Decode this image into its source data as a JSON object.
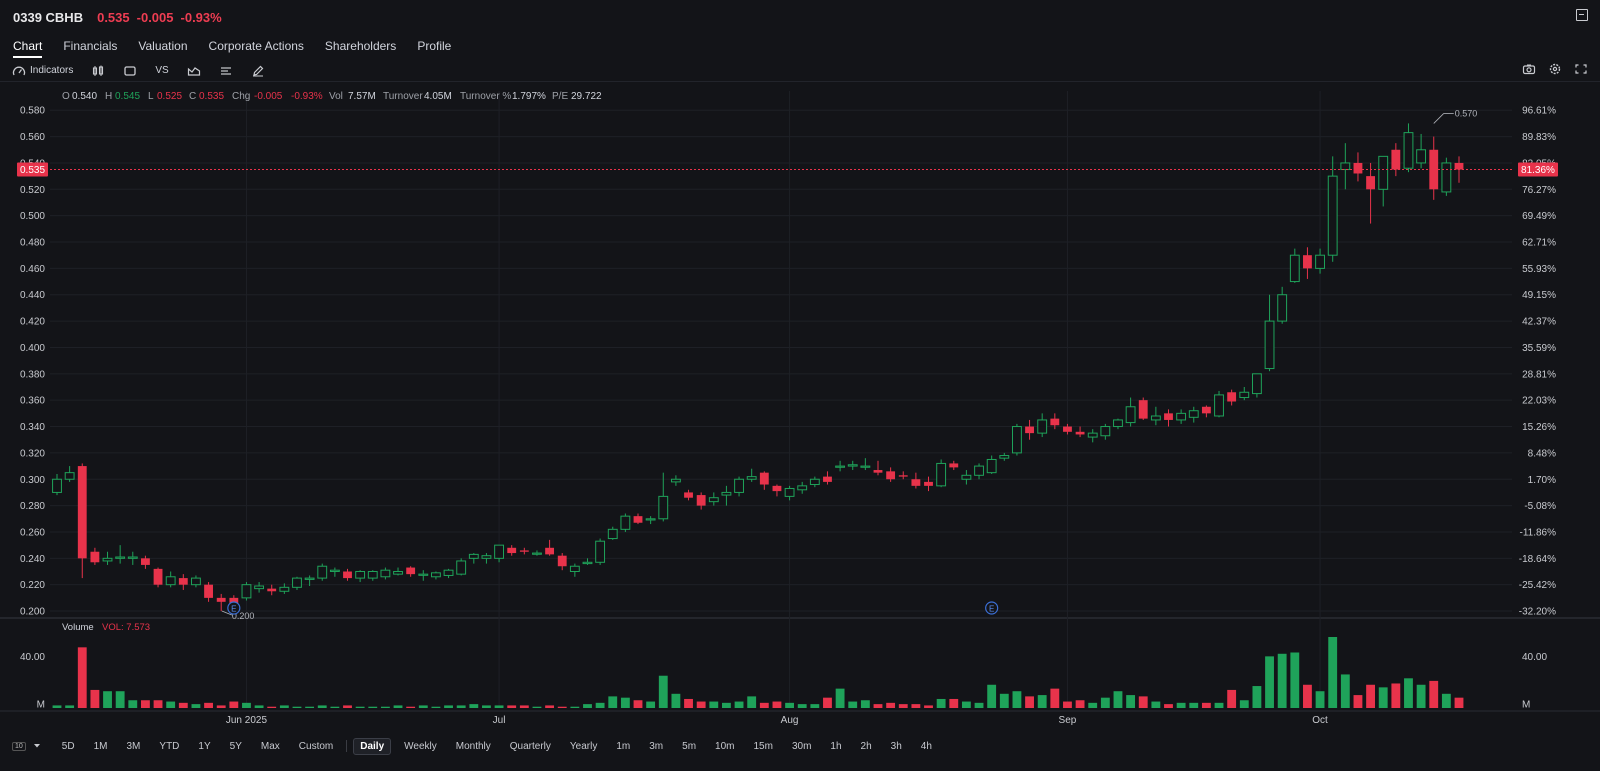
{
  "header": {
    "symbol": "0339 CBHB",
    "price": "0.535",
    "change": "-0.005",
    "change_pct": "-0.93%"
  },
  "tabs": [
    "Chart",
    "Financials",
    "Valuation",
    "Corporate Actions",
    "Shareholders",
    "Profile"
  ],
  "toolbar": {
    "indicators_label": "Indicators",
    "vs_label": "VS"
  },
  "ohlc_bar": {
    "o_label": "O",
    "o_value": "0.540",
    "h_label": "H",
    "h_value": "0.545",
    "l_label": "L",
    "l_value": "0.525",
    "c_label": "C",
    "c_value": "0.535",
    "chg_label": "Chg",
    "chg_value": "-0.005",
    "chg_pct": "-0.93%",
    "vol_label": "Vol",
    "vol_value": "7.57M",
    "turnover_label": "Turnover",
    "turnover_value": "4.05M",
    "turnover_pct_label": "Turnover %",
    "turnover_pct_value": "1.797%",
    "pe_label": "P/E",
    "pe_value": "29.722"
  },
  "volume_legend": {
    "label": "Volume",
    "value_text": "VOL: 7.573"
  },
  "footer": {
    "interval_box": "10",
    "ranges": [
      "5D",
      "1M",
      "3M",
      "YTD",
      "1Y",
      "5Y",
      "Max",
      "Custom"
    ],
    "periods": [
      "Daily",
      "Weekly",
      "Monthly",
      "Quarterly",
      "Yearly",
      "1m",
      "3m",
      "5m",
      "10m",
      "15m",
      "30m",
      "1h",
      "2h",
      "3h",
      "4h"
    ],
    "selected_period": "Daily"
  },
  "colors": {
    "up": "#1fa35a",
    "down": "#e8334b",
    "background": "#131418",
    "grid": "#1e2026",
    "text": "#d1d4dc"
  },
  "chart_data": {
    "type": "candlestick",
    "y_ticks": [
      "0.580",
      "0.560",
      "0.540",
      "0.520",
      "0.500",
      "0.480",
      "0.460",
      "0.440",
      "0.420",
      "0.400",
      "0.380",
      "0.360",
      "0.340",
      "0.320",
      "0.300",
      "0.280",
      "0.260",
      "0.240",
      "0.220",
      "0.200"
    ],
    "y_right_ticks": [
      "96.61%",
      "89.83%",
      "83.05%",
      "76.27%",
      "69.49%",
      "62.71%",
      "55.93%",
      "49.15%",
      "42.37%",
      "35.59%",
      "28.81%",
      "22.03%",
      "15.26%",
      "8.48%",
      "1.70%",
      "-5.08%",
      "-11.86%",
      "-18.64%",
      "-25.42%",
      "-32.20%"
    ],
    "ylim": [
      0.197,
      0.587
    ],
    "last_price": 0.535,
    "last_price_label": "0.535",
    "last_pct_label": "81.36%",
    "x_labels": [
      {
        "label": "Jun 2025",
        "index": 15
      },
      {
        "label": "Jul",
        "index": 35
      },
      {
        "label": "Aug",
        "index": 58
      },
      {
        "label": "Sep",
        "index": 80
      },
      {
        "label": "Oct",
        "index": 100
      }
    ],
    "high_annotation": {
      "label": "0.570",
      "index": 109,
      "value": 0.57
    },
    "low_annotation": {
      "label": "0.200",
      "index": 14,
      "value": 0.2
    },
    "events": [
      {
        "label": "E",
        "index": 14
      },
      {
        "label": "E",
        "index": 74
      }
    ],
    "volume_ticks": [
      {
        "label": "40.00",
        "value": 40
      },
      {
        "label": "M",
        "value": 0
      }
    ],
    "volume_max": 55,
    "volume_right_ticks": [
      {
        "label": "40.00",
        "value": 40
      },
      {
        "label": "M",
        "value": 0
      }
    ],
    "candles": [
      {
        "o": 0.29,
        "h": 0.304,
        "l": 0.288,
        "c": 0.3,
        "v": 2
      },
      {
        "o": 0.3,
        "h": 0.31,
        "l": 0.298,
        "c": 0.305,
        "v": 2
      },
      {
        "o": 0.31,
        "h": 0.312,
        "l": 0.225,
        "c": 0.24,
        "v": 47
      },
      {
        "o": 0.245,
        "h": 0.248,
        "l": 0.235,
        "c": 0.237,
        "v": 14
      },
      {
        "o": 0.238,
        "h": 0.245,
        "l": 0.235,
        "c": 0.24,
        "v": 13
      },
      {
        "o": 0.24,
        "h": 0.25,
        "l": 0.236,
        "c": 0.241,
        "v": 13
      },
      {
        "o": 0.24,
        "h": 0.245,
        "l": 0.235,
        "c": 0.241,
        "v": 6
      },
      {
        "o": 0.24,
        "h": 0.242,
        "l": 0.232,
        "c": 0.235,
        "v": 6
      },
      {
        "o": 0.232,
        "h": 0.233,
        "l": 0.218,
        "c": 0.22,
        "v": 6
      },
      {
        "o": 0.22,
        "h": 0.23,
        "l": 0.218,
        "c": 0.226,
        "v": 5
      },
      {
        "o": 0.225,
        "h": 0.228,
        "l": 0.216,
        "c": 0.22,
        "v": 4
      },
      {
        "o": 0.22,
        "h": 0.227,
        "l": 0.218,
        "c": 0.225,
        "v": 3
      },
      {
        "o": 0.22,
        "h": 0.222,
        "l": 0.207,
        "c": 0.21,
        "v": 4
      },
      {
        "o": 0.21,
        "h": 0.213,
        "l": 0.2,
        "c": 0.207,
        "v": 2
      },
      {
        "o": 0.21,
        "h": 0.212,
        "l": 0.202,
        "c": 0.205,
        "v": 5
      },
      {
        "o": 0.21,
        "h": 0.222,
        "l": 0.208,
        "c": 0.22,
        "v": 4
      },
      {
        "o": 0.217,
        "h": 0.222,
        "l": 0.214,
        "c": 0.219,
        "v": 2
      },
      {
        "o": 0.217,
        "h": 0.22,
        "l": 0.212,
        "c": 0.215,
        "v": 1
      },
      {
        "o": 0.215,
        "h": 0.221,
        "l": 0.213,
        "c": 0.218,
        "v": 2
      },
      {
        "o": 0.218,
        "h": 0.226,
        "l": 0.216,
        "c": 0.225,
        "v": 1
      },
      {
        "o": 0.224,
        "h": 0.227,
        "l": 0.219,
        "c": 0.225,
        "v": 1
      },
      {
        "o": 0.225,
        "h": 0.236,
        "l": 0.223,
        "c": 0.234,
        "v": 2
      },
      {
        "o": 0.23,
        "h": 0.233,
        "l": 0.226,
        "c": 0.231,
        "v": 1
      },
      {
        "o": 0.23,
        "h": 0.232,
        "l": 0.223,
        "c": 0.225,
        "v": 2
      },
      {
        "o": 0.225,
        "h": 0.231,
        "l": 0.222,
        "c": 0.23,
        "v": 1
      },
      {
        "o": 0.225,
        "h": 0.231,
        "l": 0.223,
        "c": 0.23,
        "v": 1
      },
      {
        "o": 0.226,
        "h": 0.233,
        "l": 0.224,
        "c": 0.231,
        "v": 1
      },
      {
        "o": 0.228,
        "h": 0.233,
        "l": 0.227,
        "c": 0.23,
        "v": 2
      },
      {
        "o": 0.233,
        "h": 0.234,
        "l": 0.226,
        "c": 0.228,
        "v": 1
      },
      {
        "o": 0.228,
        "h": 0.231,
        "l": 0.223,
        "c": 0.228,
        "v": 2
      },
      {
        "o": 0.226,
        "h": 0.23,
        "l": 0.224,
        "c": 0.229,
        "v": 1
      },
      {
        "o": 0.227,
        "h": 0.232,
        "l": 0.225,
        "c": 0.231,
        "v": 2
      },
      {
        "o": 0.228,
        "h": 0.24,
        "l": 0.227,
        "c": 0.238,
        "v": 2
      },
      {
        "o": 0.24,
        "h": 0.244,
        "l": 0.236,
        "c": 0.243,
        "v": 3
      },
      {
        "o": 0.24,
        "h": 0.244,
        "l": 0.236,
        "c": 0.242,
        "v": 2
      },
      {
        "o": 0.24,
        "h": 0.248,
        "l": 0.237,
        "c": 0.25,
        "v": 2
      },
      {
        "o": 0.248,
        "h": 0.25,
        "l": 0.242,
        "c": 0.244,
        "v": 2
      },
      {
        "o": 0.246,
        "h": 0.248,
        "l": 0.243,
        "c": 0.245,
        "v": 2
      },
      {
        "o": 0.244,
        "h": 0.246,
        "l": 0.242,
        "c": 0.244,
        "v": 1
      },
      {
        "o": 0.248,
        "h": 0.254,
        "l": 0.242,
        "c": 0.243,
        "v": 2
      },
      {
        "o": 0.242,
        "h": 0.244,
        "l": 0.231,
        "c": 0.234,
        "v": 1
      },
      {
        "o": 0.23,
        "h": 0.236,
        "l": 0.226,
        "c": 0.234,
        "v": 1
      },
      {
        "o": 0.236,
        "h": 0.24,
        "l": 0.235,
        "c": 0.237,
        "v": 3
      },
      {
        "o": 0.237,
        "h": 0.255,
        "l": 0.235,
        "c": 0.253,
        "v": 4
      },
      {
        "o": 0.255,
        "h": 0.264,
        "l": 0.254,
        "c": 0.262,
        "v": 9
      },
      {
        "o": 0.262,
        "h": 0.274,
        "l": 0.26,
        "c": 0.272,
        "v": 8
      },
      {
        "o": 0.272,
        "h": 0.274,
        "l": 0.266,
        "c": 0.267,
        "v": 6
      },
      {
        "o": 0.27,
        "h": 0.272,
        "l": 0.266,
        "c": 0.27,
        "v": 5
      },
      {
        "o": 0.27,
        "h": 0.305,
        "l": 0.268,
        "c": 0.287,
        "v": 25
      },
      {
        "o": 0.298,
        "h": 0.303,
        "l": 0.295,
        "c": 0.3,
        "v": 11
      },
      {
        "o": 0.29,
        "h": 0.292,
        "l": 0.284,
        "c": 0.286,
        "v": 7
      },
      {
        "o": 0.288,
        "h": 0.29,
        "l": 0.277,
        "c": 0.28,
        "v": 5
      },
      {
        "o": 0.283,
        "h": 0.29,
        "l": 0.28,
        "c": 0.286,
        "v": 5
      },
      {
        "o": 0.288,
        "h": 0.295,
        "l": 0.28,
        "c": 0.29,
        "v": 4
      },
      {
        "o": 0.29,
        "h": 0.302,
        "l": 0.287,
        "c": 0.3,
        "v": 5
      },
      {
        "o": 0.3,
        "h": 0.308,
        "l": 0.298,
        "c": 0.302,
        "v": 9
      },
      {
        "o": 0.305,
        "h": 0.306,
        "l": 0.292,
        "c": 0.296,
        "v": 4
      },
      {
        "o": 0.295,
        "h": 0.296,
        "l": 0.287,
        "c": 0.291,
        "v": 5
      },
      {
        "o": 0.287,
        "h": 0.295,
        "l": 0.284,
        "c": 0.293,
        "v": 4
      },
      {
        "o": 0.292,
        "h": 0.298,
        "l": 0.289,
        "c": 0.295,
        "v": 3
      },
      {
        "o": 0.296,
        "h": 0.302,
        "l": 0.294,
        "c": 0.3,
        "v": 3
      },
      {
        "o": 0.302,
        "h": 0.306,
        "l": 0.296,
        "c": 0.298,
        "v": 8
      },
      {
        "o": 0.31,
        "h": 0.314,
        "l": 0.306,
        "c": 0.31,
        "v": 15
      },
      {
        "o": 0.31,
        "h": 0.314,
        "l": 0.307,
        "c": 0.311,
        "v": 5
      },
      {
        "o": 0.31,
        "h": 0.316,
        "l": 0.307,
        "c": 0.31,
        "v": 6
      },
      {
        "o": 0.307,
        "h": 0.314,
        "l": 0.303,
        "c": 0.305,
        "v": 3
      },
      {
        "o": 0.306,
        "h": 0.309,
        "l": 0.298,
        "c": 0.3,
        "v": 4
      },
      {
        "o": 0.303,
        "h": 0.306,
        "l": 0.3,
        "c": 0.302,
        "v": 3
      },
      {
        "o": 0.3,
        "h": 0.305,
        "l": 0.293,
        "c": 0.295,
        "v": 3
      },
      {
        "o": 0.298,
        "h": 0.302,
        "l": 0.291,
        "c": 0.295,
        "v": 2
      },
      {
        "o": 0.295,
        "h": 0.315,
        "l": 0.294,
        "c": 0.312,
        "v": 7
      },
      {
        "o": 0.312,
        "h": 0.314,
        "l": 0.307,
        "c": 0.309,
        "v": 7
      },
      {
        "o": 0.3,
        "h": 0.307,
        "l": 0.296,
        "c": 0.303,
        "v": 5
      },
      {
        "o": 0.303,
        "h": 0.312,
        "l": 0.3,
        "c": 0.31,
        "v": 4
      },
      {
        "o": 0.305,
        "h": 0.318,
        "l": 0.304,
        "c": 0.315,
        "v": 18
      },
      {
        "o": 0.316,
        "h": 0.32,
        "l": 0.314,
        "c": 0.318,
        "v": 11
      },
      {
        "o": 0.32,
        "h": 0.342,
        "l": 0.318,
        "c": 0.34,
        "v": 13
      },
      {
        "o": 0.34,
        "h": 0.345,
        "l": 0.33,
        "c": 0.335,
        "v": 9
      },
      {
        "o": 0.335,
        "h": 0.35,
        "l": 0.332,
        "c": 0.345,
        "v": 10
      },
      {
        "o": 0.346,
        "h": 0.35,
        "l": 0.338,
        "c": 0.341,
        "v": 15
      },
      {
        "o": 0.34,
        "h": 0.342,
        "l": 0.334,
        "c": 0.336,
        "v": 5
      },
      {
        "o": 0.336,
        "h": 0.34,
        "l": 0.332,
        "c": 0.334,
        "v": 6
      },
      {
        "o": 0.332,
        "h": 0.338,
        "l": 0.328,
        "c": 0.335,
        "v": 4
      },
      {
        "o": 0.333,
        "h": 0.342,
        "l": 0.33,
        "c": 0.34,
        "v": 8
      },
      {
        "o": 0.34,
        "h": 0.346,
        "l": 0.338,
        "c": 0.345,
        "v": 13
      },
      {
        "o": 0.343,
        "h": 0.362,
        "l": 0.34,
        "c": 0.355,
        "v": 10
      },
      {
        "o": 0.36,
        "h": 0.362,
        "l": 0.345,
        "c": 0.346,
        "v": 9
      },
      {
        "o": 0.345,
        "h": 0.355,
        "l": 0.341,
        "c": 0.348,
        "v": 5
      },
      {
        "o": 0.35,
        "h": 0.353,
        "l": 0.34,
        "c": 0.345,
        "v": 3
      },
      {
        "o": 0.345,
        "h": 0.353,
        "l": 0.342,
        "c": 0.35,
        "v": 4
      },
      {
        "o": 0.347,
        "h": 0.355,
        "l": 0.343,
        "c": 0.352,
        "v": 4
      },
      {
        "o": 0.355,
        "h": 0.356,
        "l": 0.347,
        "c": 0.35,
        "v": 4
      },
      {
        "o": 0.348,
        "h": 0.367,
        "l": 0.347,
        "c": 0.364,
        "v": 4
      },
      {
        "o": 0.366,
        "h": 0.368,
        "l": 0.356,
        "c": 0.359,
        "v": 14
      },
      {
        "o": 0.362,
        "h": 0.37,
        "l": 0.36,
        "c": 0.366,
        "v": 6
      },
      {
        "o": 0.365,
        "h": 0.38,
        "l": 0.362,
        "c": 0.38,
        "v": 17
      },
      {
        "o": 0.384,
        "h": 0.44,
        "l": 0.382,
        "c": 0.42,
        "v": 40
      },
      {
        "o": 0.42,
        "h": 0.446,
        "l": 0.418,
        "c": 0.44,
        "v": 42
      },
      {
        "o": 0.45,
        "h": 0.475,
        "l": 0.449,
        "c": 0.47,
        "v": 43
      },
      {
        "o": 0.47,
        "h": 0.476,
        "l": 0.452,
        "c": 0.46,
        "v": 18
      },
      {
        "o": 0.46,
        "h": 0.475,
        "l": 0.456,
        "c": 0.47,
        "v": 13
      },
      {
        "o": 0.47,
        "h": 0.545,
        "l": 0.465,
        "c": 0.53,
        "v": 55
      },
      {
        "o": 0.535,
        "h": 0.555,
        "l": 0.52,
        "c": 0.54,
        "v": 26
      },
      {
        "o": 0.54,
        "h": 0.548,
        "l": 0.526,
        "c": 0.532,
        "v": 10
      },
      {
        "o": 0.53,
        "h": 0.54,
        "l": 0.494,
        "c": 0.52,
        "v": 18
      },
      {
        "o": 0.52,
        "h": 0.545,
        "l": 0.507,
        "c": 0.545,
        "v": 16
      },
      {
        "o": 0.55,
        "h": 0.555,
        "l": 0.53,
        "c": 0.535,
        "v": 19
      },
      {
        "o": 0.536,
        "h": 0.57,
        "l": 0.533,
        "c": 0.563,
        "v": 23
      },
      {
        "o": 0.54,
        "h": 0.562,
        "l": 0.536,
        "c": 0.55,
        "v": 18
      },
      {
        "o": 0.55,
        "h": 0.56,
        "l": 0.512,
        "c": 0.52,
        "v": 21
      },
      {
        "o": 0.518,
        "h": 0.544,
        "l": 0.515,
        "c": 0.54,
        "v": 11
      },
      {
        "o": 0.54,
        "h": 0.545,
        "l": 0.525,
        "c": 0.535,
        "v": 8
      }
    ]
  }
}
